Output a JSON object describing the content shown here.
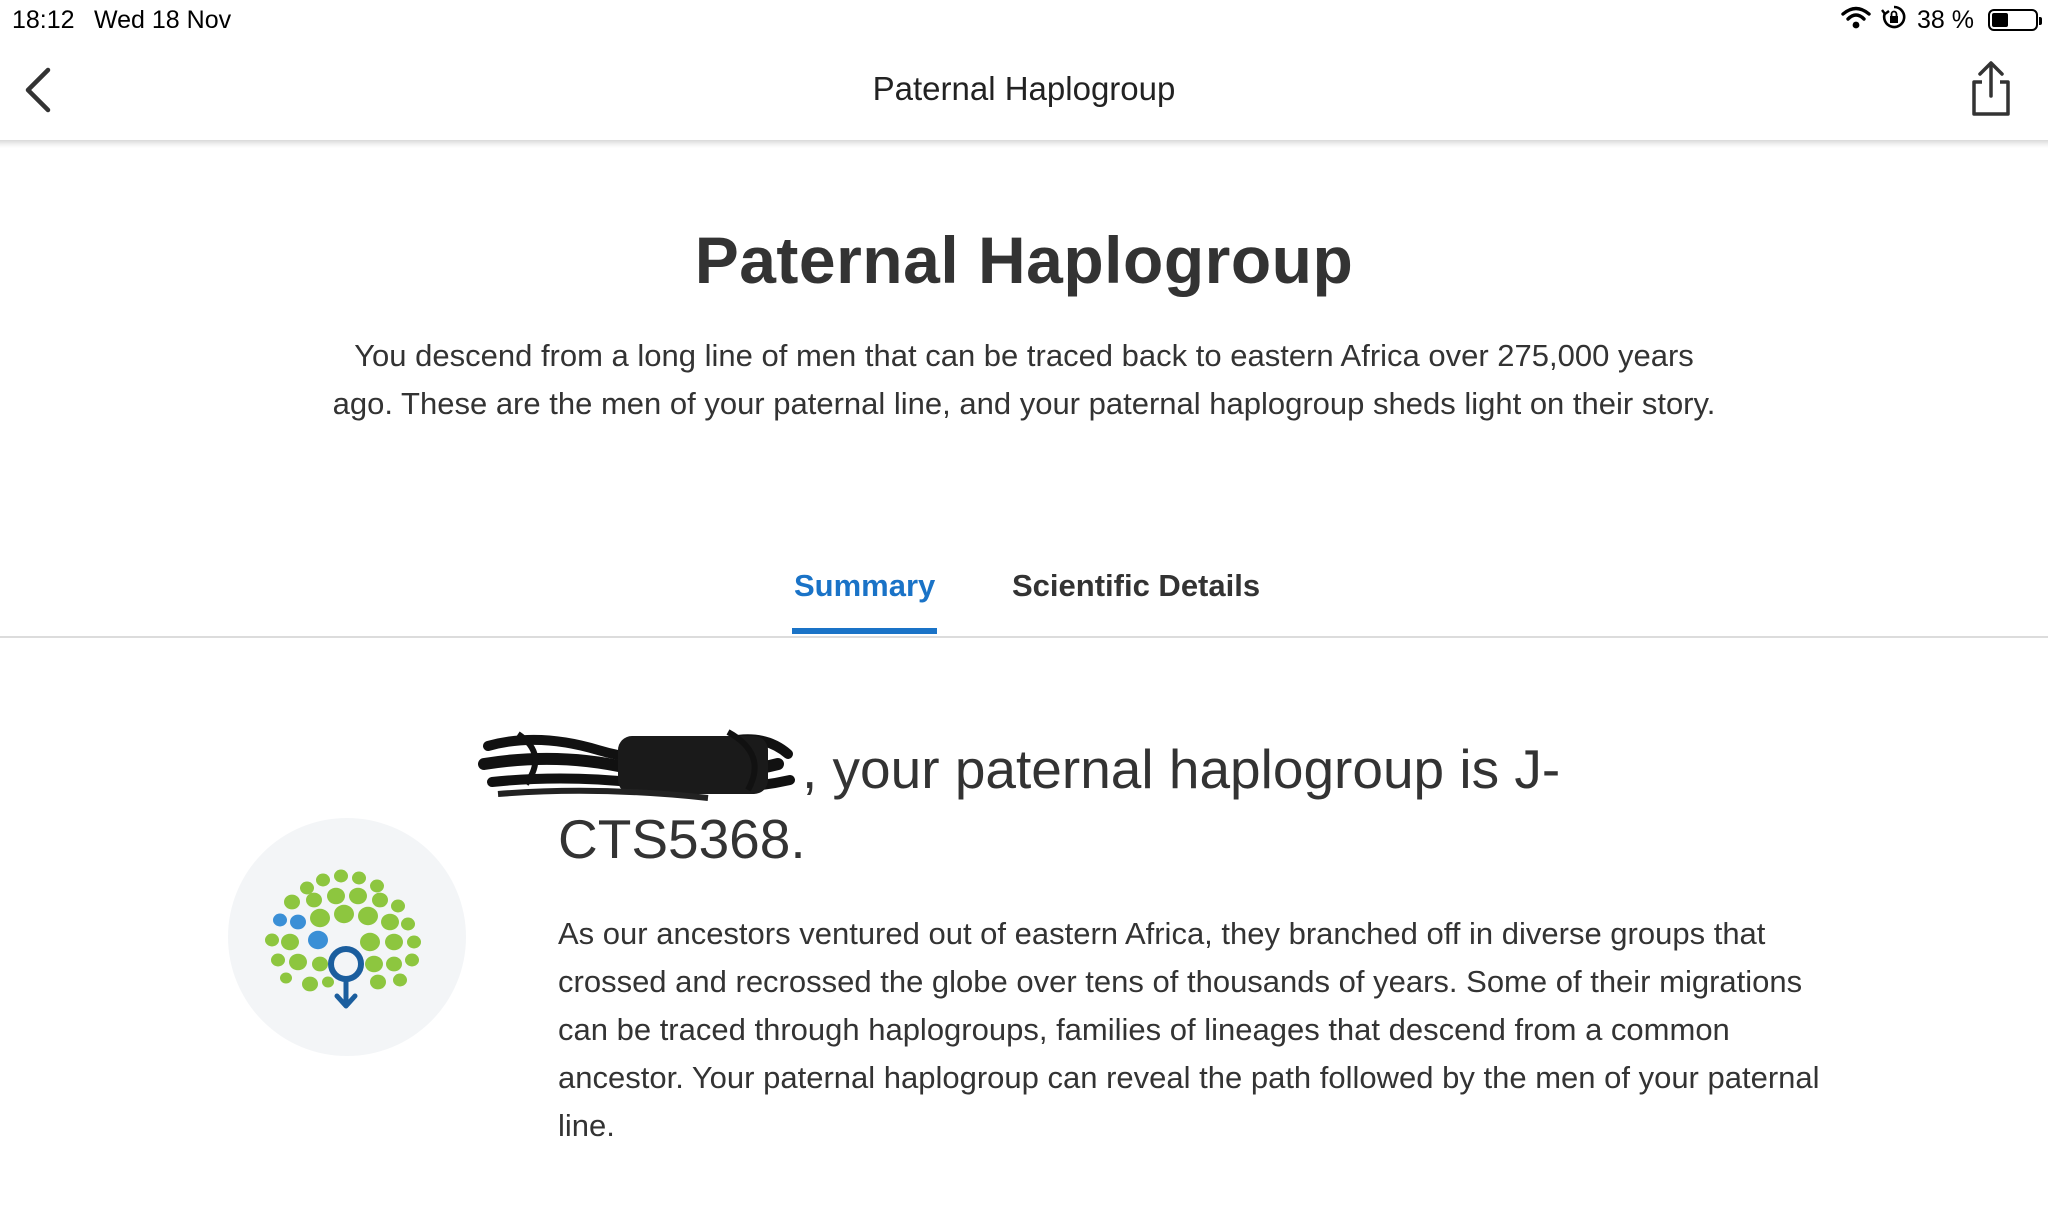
{
  "status_bar": {
    "time": "18:12",
    "date": "Wed 18 Nov",
    "battery_label": "38 %",
    "battery_level": 0.38,
    "wifi_icon": "wifi-icon",
    "lock_rotation_icon": "orientation-lock-icon"
  },
  "nav": {
    "title": "Paternal Haplogroup",
    "back_icon": "chevron-left-icon",
    "share_icon": "share-icon"
  },
  "page": {
    "title": "Paternal Haplogroup",
    "intro": "You descend from a long line of men that can be traced back to eastern Africa over 275,000 years ago. These are the men of your paternal line, and your paternal haplogroup sheds light on their story."
  },
  "tabs": [
    {
      "label": "Summary",
      "active": true
    },
    {
      "label": "Scientific Details",
      "active": false
    }
  ],
  "summary": {
    "headline": ", your paternal haplogroup is J-CTS5368.",
    "body": "As our ancestors ventured out of eastern Africa, they branched off in diverse groups that crossed and recrossed the globe over tens of thousands of years. Some of their migrations can be traced through haplogroups, families of lineages that descend from a common ancestor. Your paternal haplogroup can reveal the path followed by the men of your paternal line.",
    "icon": "haplogroup-tree-icon"
  },
  "colors": {
    "accent": "#1a73c7",
    "leaf_green": "#8dc63f",
    "leaf_blue": "#3a8fd6",
    "male_symbol": "#1b5e9e",
    "icon_background": "#f3f5f7"
  }
}
